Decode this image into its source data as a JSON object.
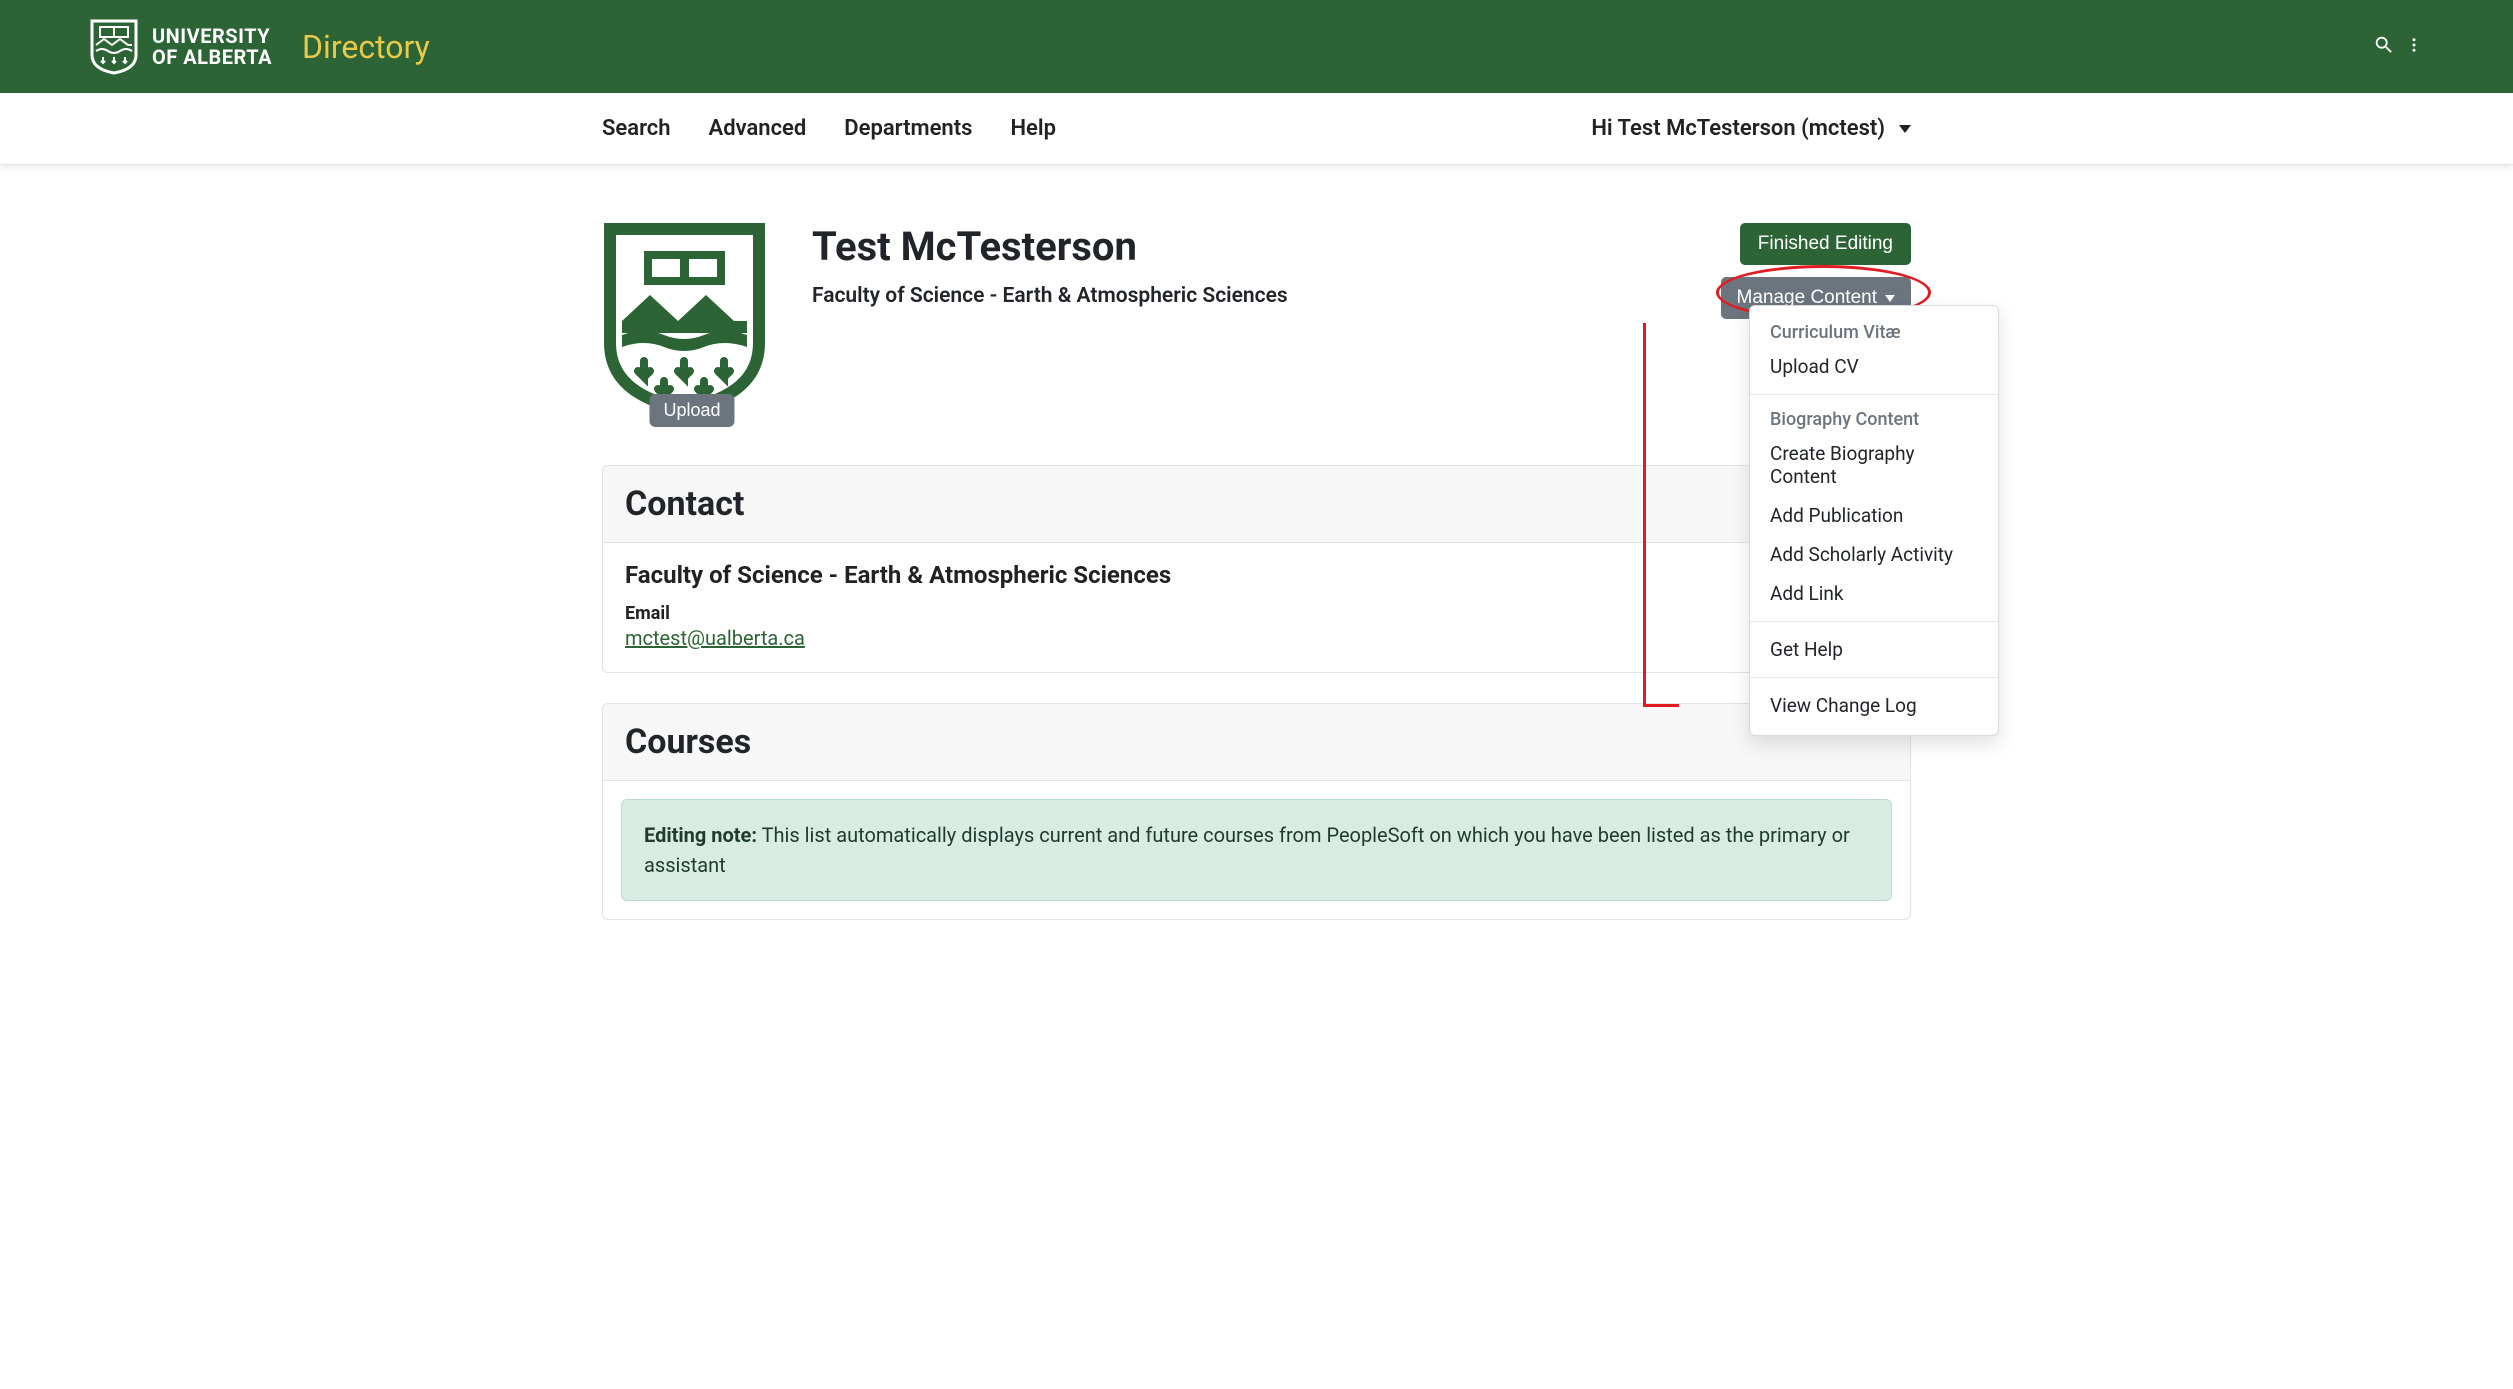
{
  "header": {
    "university_line1": "UNIVERSITY",
    "university_line2": "OF ALBERTA",
    "site_title": "Directory"
  },
  "nav": {
    "links": [
      "Search",
      "Advanced",
      "Departments",
      "Help"
    ],
    "user_greeting": "Hi Test McTesterson (mctest)"
  },
  "profile": {
    "name": "Test McTesterson",
    "affiliation": "Faculty of Science - Earth & Atmospheric Sciences",
    "upload_label": "Upload"
  },
  "actions": {
    "finished_label": "Finished Editing",
    "manage_label": "Manage Content"
  },
  "dropdown": {
    "cv_header": "Curriculum Vitæ",
    "upload_cv": "Upload CV",
    "bio_header": "Biography Content",
    "create_bio": "Create Biography Content",
    "add_pub": "Add Publication",
    "add_scholarly": "Add Scholarly Activity",
    "add_link": "Add Link",
    "get_help": "Get Help",
    "view_log": "View Change Log"
  },
  "contact_card": {
    "title": "Contact",
    "department": "Faculty of Science - Earth & Atmospheric Sciences",
    "email_label": "Email",
    "email_value": "mctest@ualberta.ca"
  },
  "courses_card": {
    "title": "Courses",
    "note_prefix": "Editing note:",
    "note_body": " This list automatically displays current and future courses from PeopleSoft on which you have been listed as the primary or assistant"
  }
}
